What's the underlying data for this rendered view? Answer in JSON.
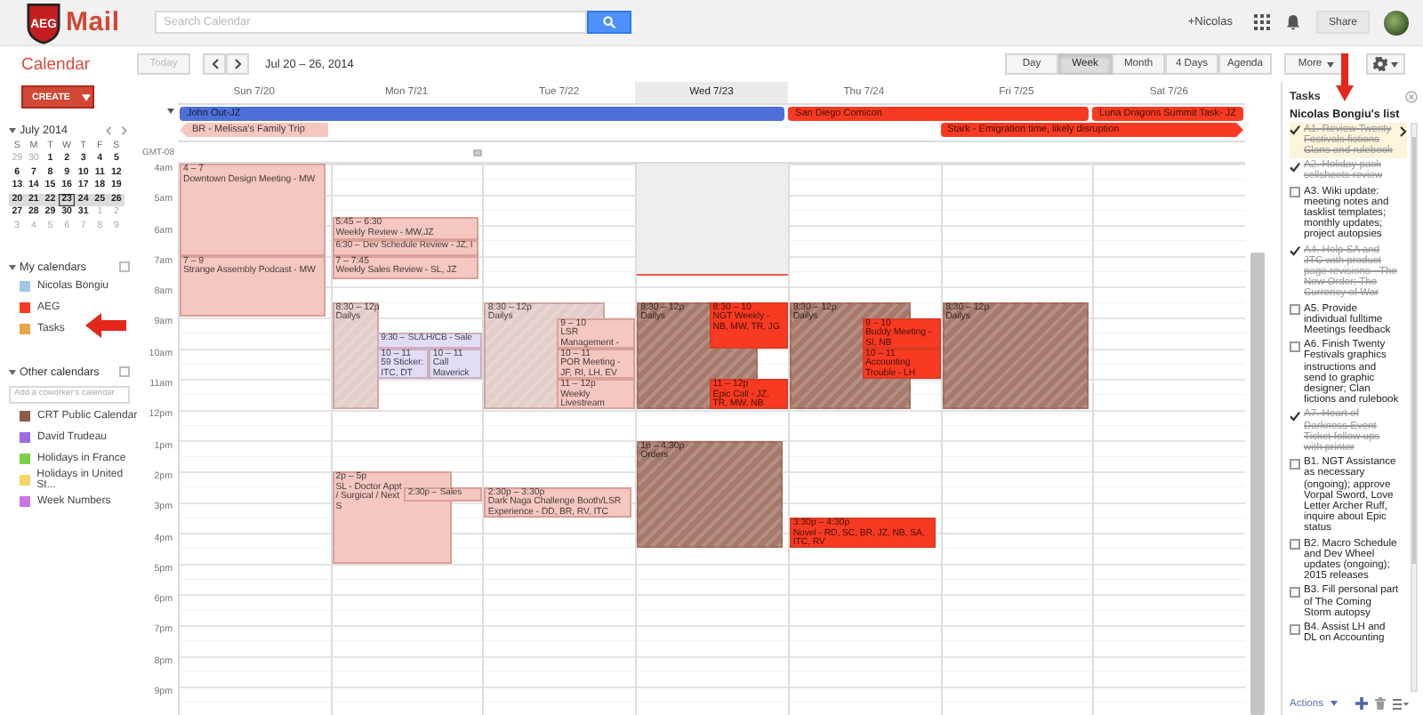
{
  "header": {
    "logo_badge": "AEG",
    "logo_word": "Mail",
    "search": {
      "placeholder": "Search Calendar"
    },
    "user": "+Nicolas",
    "share": "Share"
  },
  "toolbar": {
    "title": "Calendar",
    "today": "Today",
    "date_range": "Jul 20 – 26, 2014",
    "views": [
      {
        "label": "Day",
        "selected": false
      },
      {
        "label": "Week",
        "selected": true
      },
      {
        "label": "Month",
        "selected": false
      },
      {
        "label": "4 Days",
        "selected": false
      },
      {
        "label": "Agenda",
        "selected": false
      }
    ],
    "more": "More"
  },
  "sidebar": {
    "create": "CREATE",
    "mini_calendar": {
      "month": "July 2014",
      "weekdays": [
        "S",
        "M",
        "T",
        "W",
        "T",
        "F",
        "S"
      ],
      "weeks": [
        {
          "selected": false,
          "days": [
            {
              "label": "29",
              "in_month": false,
              "today": false
            },
            {
              "label": "30",
              "in_month": false,
              "today": false
            },
            {
              "label": "1",
              "in_month": true,
              "today": false
            },
            {
              "label": "2",
              "in_month": true,
              "today": false
            },
            {
              "label": "3",
              "in_month": true,
              "today": false
            },
            {
              "label": "4",
              "in_month": true,
              "today": false
            },
            {
              "label": "5",
              "in_month": true,
              "today": false
            }
          ]
        },
        {
          "selected": false,
          "days": [
            {
              "label": "6",
              "in_month": true,
              "today": false
            },
            {
              "label": "7",
              "in_month": true,
              "today": false
            },
            {
              "label": "8",
              "in_month": true,
              "today": false
            },
            {
              "label": "9",
              "in_month": true,
              "today": false
            },
            {
              "label": "10",
              "in_month": true,
              "today": false
            },
            {
              "label": "11",
              "in_month": true,
              "today": false
            },
            {
              "label": "12",
              "in_month": true,
              "today": false
            }
          ]
        },
        {
          "selected": false,
          "days": [
            {
              "label": "13",
              "in_month": true,
              "today": false
            },
            {
              "label": "14",
              "in_month": true,
              "today": false
            },
            {
              "label": "15",
              "in_month": true,
              "today": false
            },
            {
              "label": "16",
              "in_month": true,
              "today": false
            },
            {
              "label": "17",
              "in_month": true,
              "today": false
            },
            {
              "label": "18",
              "in_month": true,
              "today": false
            },
            {
              "label": "19",
              "in_month": true,
              "today": false
            }
          ]
        },
        {
          "selected": true,
          "days": [
            {
              "label": "20",
              "in_month": true,
              "today": false
            },
            {
              "label": "21",
              "in_month": true,
              "today": false
            },
            {
              "label": "22",
              "in_month": true,
              "today": false
            },
            {
              "label": "23",
              "in_month": true,
              "today": true
            },
            {
              "label": "24",
              "in_month": true,
              "today": false
            },
            {
              "label": "25",
              "in_month": true,
              "today": false
            },
            {
              "label": "26",
              "in_month": true,
              "today": false
            }
          ]
        },
        {
          "selected": false,
          "days": [
            {
              "label": "27",
              "in_month": true,
              "today": false
            },
            {
              "label": "28",
              "in_month": true,
              "today": false
            },
            {
              "label": "29",
              "in_month": true,
              "today": false
            },
            {
              "label": "30",
              "in_month": true,
              "today": false
            },
            {
              "label": "31",
              "in_month": true,
              "today": false
            },
            {
              "label": "1",
              "in_month": false,
              "today": false
            },
            {
              "label": "2",
              "in_month": false,
              "today": false
            }
          ]
        },
        {
          "selected": false,
          "days": [
            {
              "label": "3",
              "in_month": false,
              "today": false
            },
            {
              "label": "4",
              "in_month": false,
              "today": false
            },
            {
              "label": "5",
              "in_month": false,
              "today": false
            },
            {
              "label": "6",
              "in_month": false,
              "today": false
            },
            {
              "label": "7",
              "in_month": false,
              "today": false
            },
            {
              "label": "8",
              "in_month": false,
              "today": false
            },
            {
              "label": "9",
              "in_month": false,
              "today": false
            }
          ]
        }
      ]
    },
    "my_calendars": {
      "title": "My calendars",
      "items": [
        {
          "name": "Nicolas Bongiu",
          "color": "#9fc6e7"
        },
        {
          "name": "AEG",
          "color": "#f83a22"
        },
        {
          "name": "Tasks",
          "color": "#eba54a"
        }
      ]
    },
    "other_calendars": {
      "title": "Other calendars",
      "add": {
        "placeholder": "Add a coworker's calendar"
      },
      "items": [
        {
          "name": "CRT Public Calendar",
          "color": "#8f5a4e"
        },
        {
          "name": "David Trudeau",
          "color": "#9a6ce0"
        },
        {
          "name": "Holidays in France",
          "color": "#7bd148"
        },
        {
          "name": "Holidays in United St...",
          "color": "#f5d565"
        },
        {
          "name": "Week Numbers",
          "color": "#cd74e6"
        }
      ]
    }
  },
  "calendar": {
    "timezone": "GMT-08",
    "now_line": {
      "level": 0.199
    },
    "hours": [
      "4am",
      "5am",
      "6am",
      "7am",
      "8am",
      "9am",
      "10am",
      "11am",
      "12pm",
      "1pm",
      "2pm",
      "3pm",
      "4pm",
      "5pm",
      "6pm",
      "7pm",
      "8pm",
      "9pm"
    ],
    "all_day_rows": [
      {
        "cells": [
          {
            "kind": "event",
            "title": "John Out-JZ",
            "color": "#4f6fd8",
            "starts_before": false,
            "continues": false
          },
          {
            "kind": "span"
          },
          {
            "kind": "span"
          },
          {
            "kind": "span"
          },
          {
            "kind": "event",
            "title": "San Diego Comicon",
            "color": "#f83a22",
            "starts_before": false,
            "continues": false
          },
          {
            "kind": "span"
          },
          {
            "kind": "event",
            "title": "Luna Dragons Summit Task- JZ",
            "color": "#f83a22",
            "starts_before": false,
            "continues": false
          }
        ]
      },
      {
        "cells": [
          {
            "kind": "event",
            "title": "BR - Melissa's Family Trip",
            "color": "#f4c7c1",
            "starts_before": true,
            "continues": false
          },
          {
            "kind": "empty"
          },
          {
            "kind": "empty"
          },
          {
            "kind": "empty"
          },
          {
            "kind": "empty"
          },
          {
            "kind": "event",
            "title": "Stark - Emigration time, likely disruption",
            "color": "#f83a22",
            "starts_before": false,
            "continues": true
          },
          {
            "kind": "span"
          }
        ]
      }
    ],
    "days": [
      {
        "label": "Sun 7/20",
        "today": false,
        "events": [
          {
            "time": "4 – 7",
            "title": "Downtown Design Meeting - MW",
            "color": "#f4c7c1",
            "kind": "solid"
          },
          {
            "time": "7 – 9",
            "title": "Strange Assembly Podcast - MW",
            "color": "#f4c7c1",
            "kind": "solid"
          }
        ]
      },
      {
        "label": "Mon 7/21",
        "today": false,
        "events": [
          {
            "time": "5:45 – 6:30",
            "title": "Weekly Review - MW,JZ",
            "color": "#f4c7c1",
            "kind": "solid"
          },
          {
            "time": "6:30 –",
            "title": "Dev Schedule Review - JZ, I",
            "color": "#f4c7c1",
            "kind": "solid"
          },
          {
            "time": "7 – 7:45",
            "title": "Weekly Sales Review - SL, JZ",
            "color": "#f4c7c1",
            "kind": "solid"
          },
          {
            "time": "8:30 – 12p",
            "title": "Dailys",
            "color": "#e2cdc9",
            "kind": "hatched"
          },
          {
            "time": "9:30 –",
            "title": "SL/LH/CB - Sale",
            "color": "#e2dcf7",
            "kind": "solid"
          },
          {
            "time": "10 – 11",
            "title": "59 Sticker: ITC, DT",
            "color": "#e2dcf7",
            "kind": "solid"
          },
          {
            "time": "10 – 11",
            "title": "Call Maverick",
            "color": "#e2dcf7",
            "kind": "solid"
          },
          {
            "time": "2p – 5p",
            "title": "SL - Doctor Appt / Surgical / Next S",
            "color": "#f4c7c1",
            "kind": "solid"
          },
          {
            "time": "2:30p –",
            "title": "Sales",
            "color": "#f4c7c1",
            "kind": "solid"
          }
        ]
      },
      {
        "label": "Tue 7/22",
        "today": false,
        "events": [
          {
            "time": "8:30 – 12p",
            "title": "Dailys",
            "color": "#e2cdc9",
            "kind": "hatched"
          },
          {
            "time": "9 – 10",
            "title": "LSR Management -",
            "color": "#f4c7c1",
            "kind": "solid"
          },
          {
            "time": "10 – 11",
            "title": "POR Meeting - JF, RI, LH, EV",
            "color": "#f4c7c1",
            "kind": "solid"
          },
          {
            "time": "11 – 12p",
            "title": "Weekly Livestream",
            "color": "#f4c7c1",
            "kind": "solid"
          },
          {
            "time": "2:30p – 3:30p",
            "title": "Dark Naga Challenge Booth/LSR Experience - DD, BR, RV, ITC",
            "color": "#f4c7c1",
            "kind": "solid"
          }
        ]
      },
      {
        "label": "Wed 7/23",
        "today": true,
        "events": [
          {
            "time": "8:30 – 12p",
            "title": "Dailys",
            "color": "#a67a6b",
            "kind": "hatched"
          },
          {
            "time": "8:30 – 10",
            "title": "NGT Weekly - NB, MW, TR, JG",
            "color": "#f83a22",
            "kind": "solid"
          },
          {
            "time": "11 – 12p",
            "title": "Epic Call - JZ, TR, MW, NB",
            "color": "#f83a22",
            "kind": "solid"
          },
          {
            "time": "1p – 4:30p",
            "title": "Orders",
            "color": "#a67a6b",
            "kind": "hatched"
          }
        ]
      },
      {
        "label": "Thu 7/24",
        "today": false,
        "events": [
          {
            "time": "8:30 – 12p",
            "title": "Dailys",
            "color": "#a67a6b",
            "kind": "hatched"
          },
          {
            "time": "9 – 10",
            "title": "Buddy Meeting - SI, NB",
            "color": "#f83a22",
            "kind": "solid"
          },
          {
            "time": "10 – 11",
            "title": "Accounting Trouble - LH",
            "color": "#f83a22",
            "kind": "solid"
          },
          {
            "time": "3:30p – 4:30p",
            "title": "Novel - RD, SC, BR, JZ, NB, SA, ITC, RV",
            "color": "#f83a22",
            "kind": "solid"
          }
        ]
      },
      {
        "label": "Fri 7/25",
        "today": false,
        "events": [
          {
            "time": "8:30 – 12p",
            "title": "Dailys",
            "color": "#a67a6b",
            "kind": "hatched"
          }
        ]
      },
      {
        "label": "Sat 7/26",
        "today": false
      }
    ]
  },
  "tasks": {
    "title": "Tasks",
    "list_name": "Nicolas Bongiu's list",
    "actions": "Actions",
    "items": [
      {
        "text": "A1. Review Twenty Festivals fictions Clans and rulebook",
        "checked": true,
        "selected": true
      },
      {
        "text": "A2. Holiday pack sellsheets review",
        "checked": true,
        "selected": false
      },
      {
        "text": "A3. Wiki update: meeting notes and tasklist templates; monthly updates; project autopsies",
        "checked": false,
        "selected": false
      },
      {
        "text": "A4. Help SA and JTC with product page revisions - The New Order: The Currency of War",
        "checked": true,
        "selected": false
      },
      {
        "text": "A5. Provide individual fulltime Meetings feedback",
        "checked": false,
        "selected": false
      },
      {
        "text": "A6. Finish Twenty Festivals graphics instructions and send to graphic designer; Clan fictions and rulebook",
        "checked": false,
        "selected": false
      },
      {
        "text": "A7. Heart of Darkness Event Ticket follow ups with printer",
        "checked": true,
        "selected": false
      },
      {
        "text": "B1. NGT Assistance as necessary (ongoing); approve Vorpal Sword, Love Letter Archer Ruff, inquire about Epic status",
        "checked": false,
        "selected": false
      },
      {
        "text": "B2. Macro Schedule and Dev Wheel updates (ongoing); 2015 releases",
        "checked": false,
        "selected": false
      },
      {
        "text": "B3. Fill personal part of The Coming Storm autopsy",
        "checked": false,
        "selected": false
      },
      {
        "text": "B4. Assist LH and DL on Accounting",
        "checked": false,
        "selected": false
      }
    ]
  }
}
